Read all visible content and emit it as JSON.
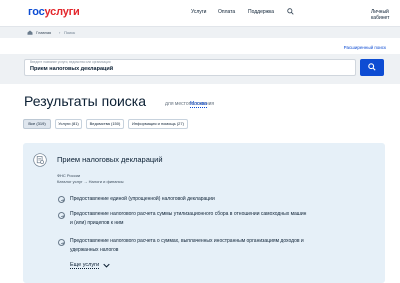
{
  "header": {
    "logo_part1": "гос",
    "logo_part2": "услуги",
    "nav": [
      "Услуги",
      "Оплата",
      "Поддержка"
    ],
    "cabinet": "Личный кабинет"
  },
  "breadcrumb": {
    "home": "Главная",
    "separator": "›",
    "current": "Поиск"
  },
  "search": {
    "advanced_link": "Расширенный поиск",
    "hint": "Введите название услуги, ведомства или организации",
    "value": "Прием налоговых деклараций"
  },
  "results": {
    "title": "Результаты поиска",
    "for_location": "для местоположения",
    "city": "Москва"
  },
  "tabs": [
    "Все (319)",
    "Услуги (81)",
    "Ведомства (150)",
    "Информация и помощь (27)"
  ],
  "card": {
    "title": "Прием налоговых деклараций",
    "org": "ФНС России",
    "path": "Каталог услуг → Налоги и финансы",
    "services": [
      "Предоставление единой (упрощенной) налоговой декларации",
      "Предоставление налогового расчета суммы утилизационного сбора в отношении самоходных машин и (или) прицепов к ним",
      "Предоставление налогового расчета о суммах, выплаченных иностранным организациям доходов и удержанных налогов"
    ],
    "more": "Еще услуги"
  },
  "colors": {
    "brand_blue": "#0d4cd3",
    "brand_red": "#e3262c",
    "card_bg": "#e6f0f8"
  }
}
